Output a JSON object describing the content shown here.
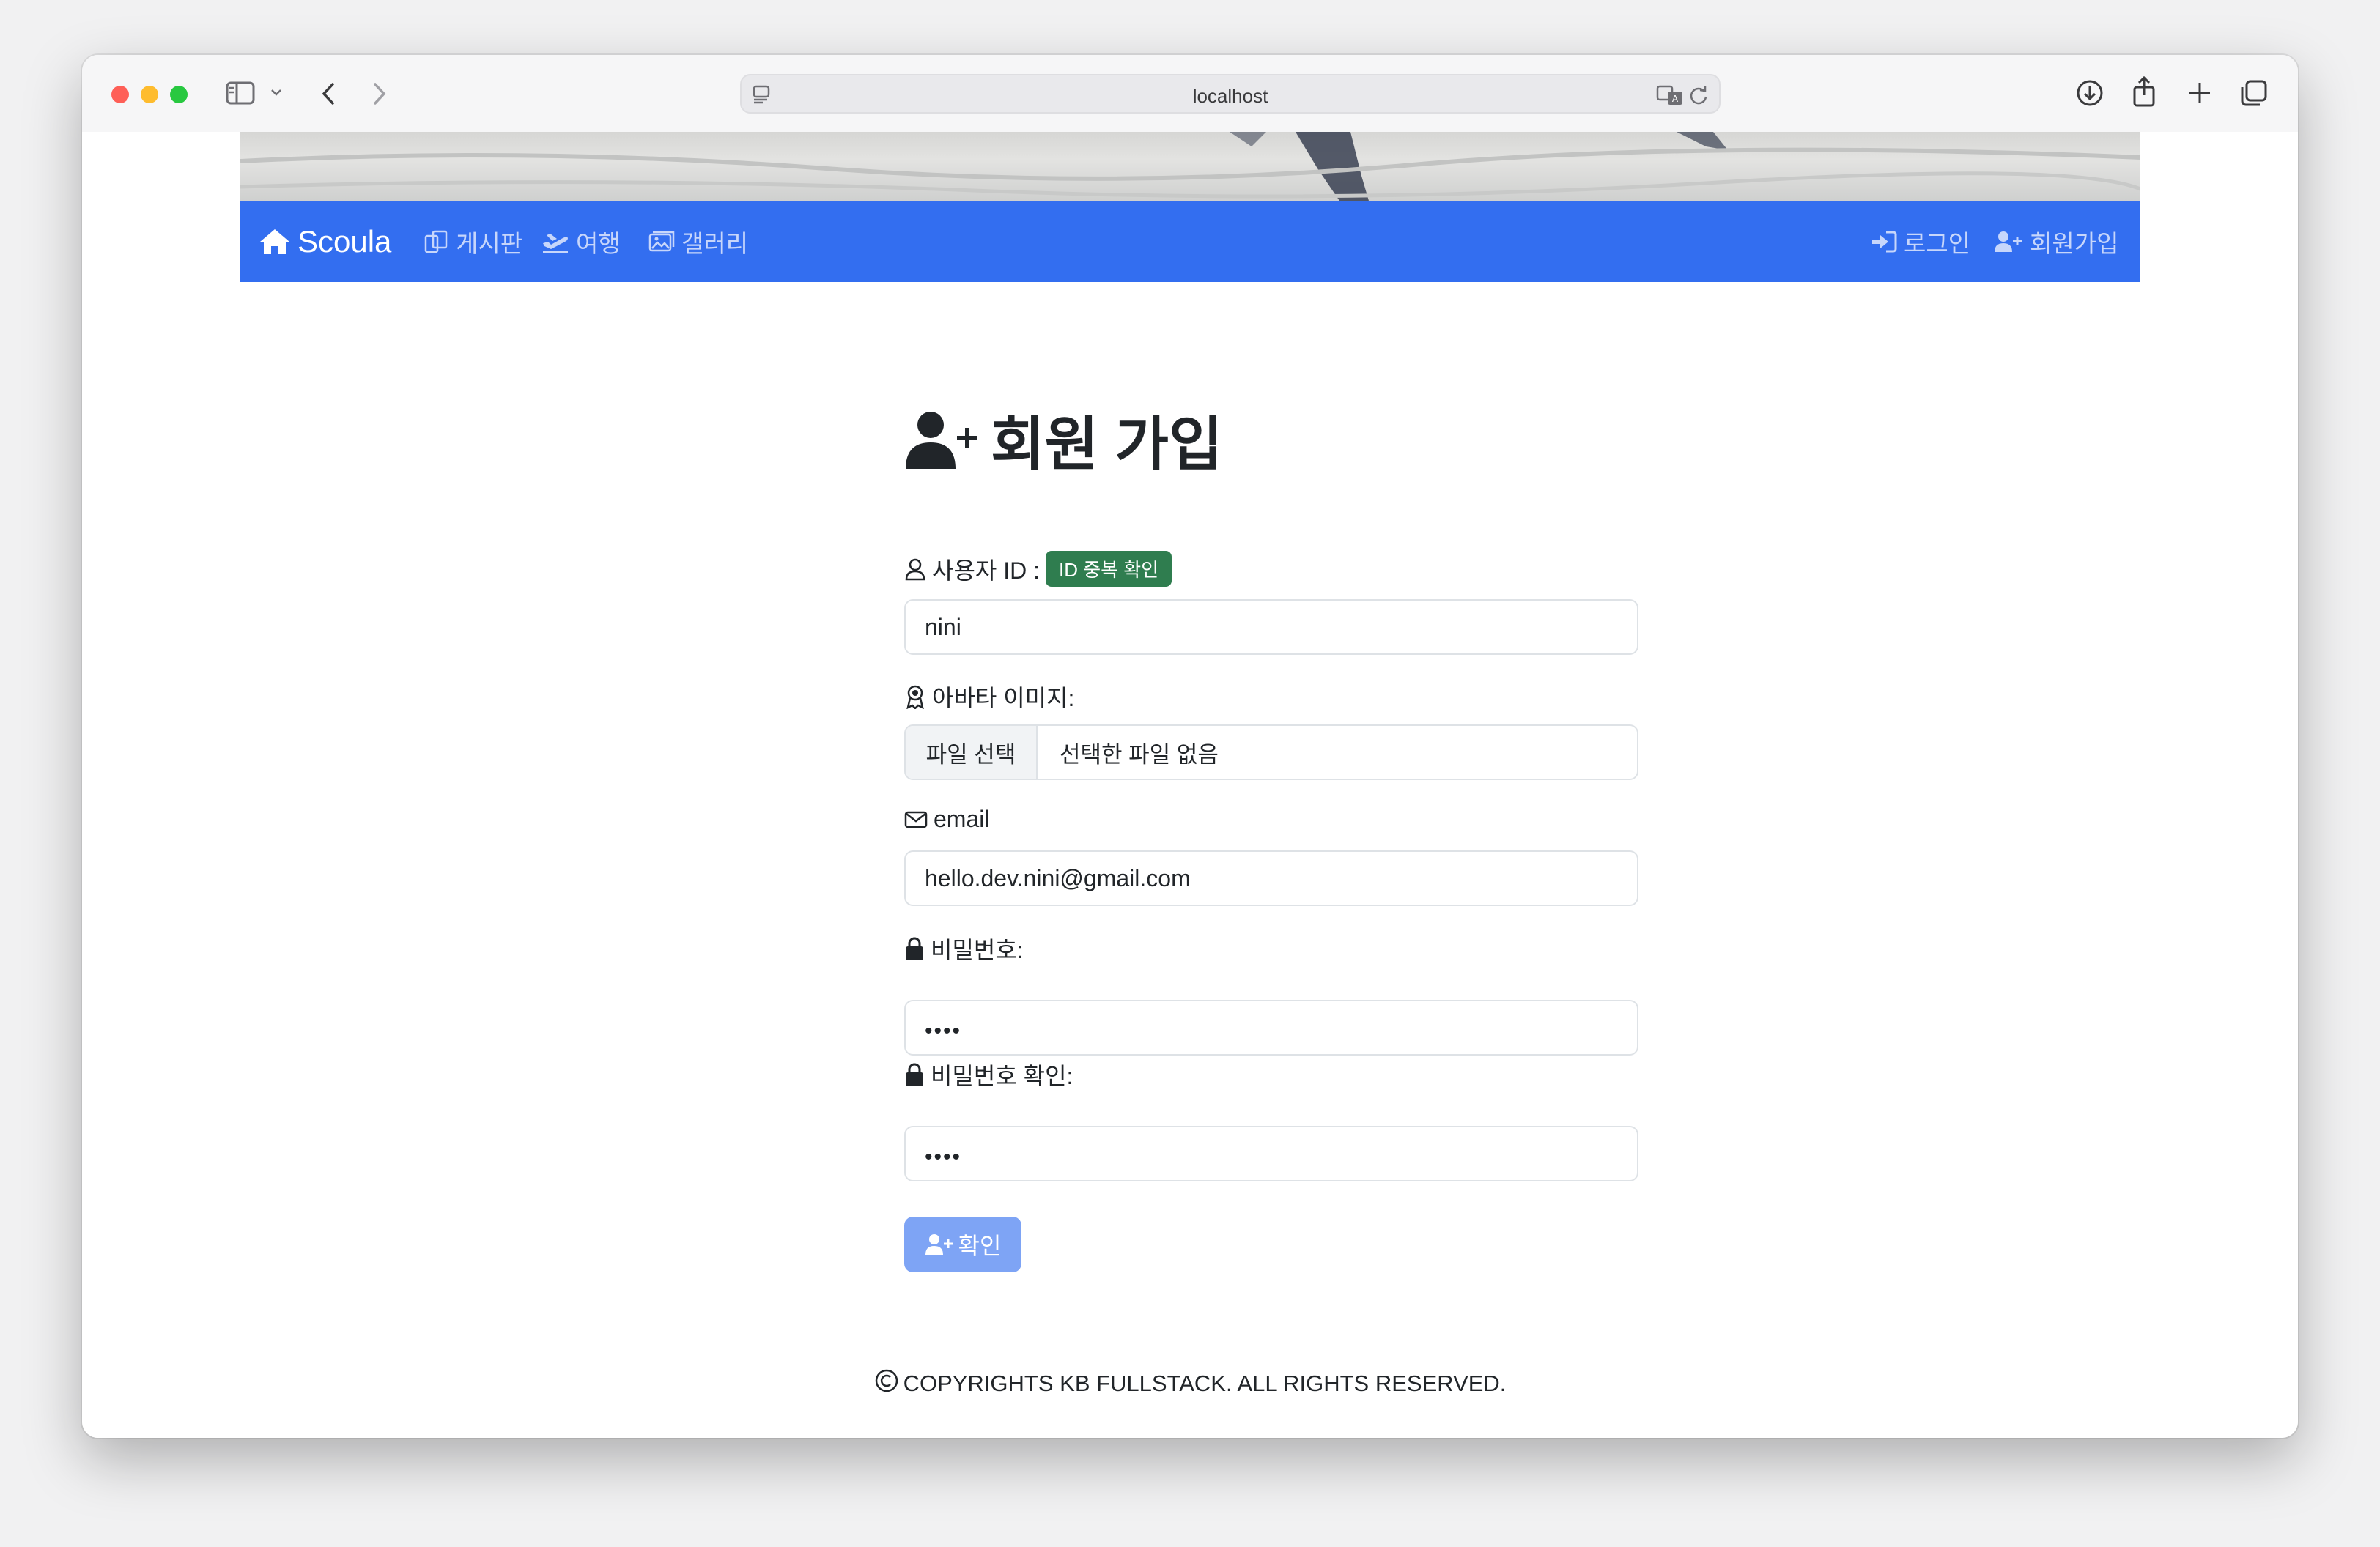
{
  "browser": {
    "url": "localhost"
  },
  "navbar": {
    "brand": "Scoula",
    "left_items": [
      {
        "label": "게시판",
        "icon": "board-icon"
      },
      {
        "label": "여행",
        "icon": "plane-icon"
      },
      {
        "label": "갤러리",
        "icon": "image-icon"
      }
    ],
    "right_items": [
      {
        "label": "로그인",
        "icon": "login-icon"
      },
      {
        "label": "회원가입",
        "icon": "user-plus-icon"
      }
    ],
    "colors": {
      "background": "#336ef0",
      "text": "#c7d6fb"
    }
  },
  "form": {
    "title": "회원 가입",
    "user_id": {
      "label": "사용자 ID :",
      "check_badge": "ID 중복 확인",
      "value": "nini"
    },
    "avatar": {
      "label": "아바타 이미지:",
      "button": "파일 선택",
      "file_status": "선택한 파일 없음"
    },
    "email": {
      "label": "email",
      "value": "hello.dev.nini@gmail.com"
    },
    "password": {
      "label": "비밀번호:",
      "masked_value": "••••"
    },
    "password_confirm": {
      "label": "비밀번호 확인:",
      "masked_value": "••••"
    },
    "submit_label": "확인",
    "colors": {
      "badge": "#2f7d4f",
      "submit": "#7ea4f5"
    }
  },
  "footer": {
    "copyright": "COPYRIGHTS KB FULLSTACK. ALL RIGHTS RESERVED."
  }
}
